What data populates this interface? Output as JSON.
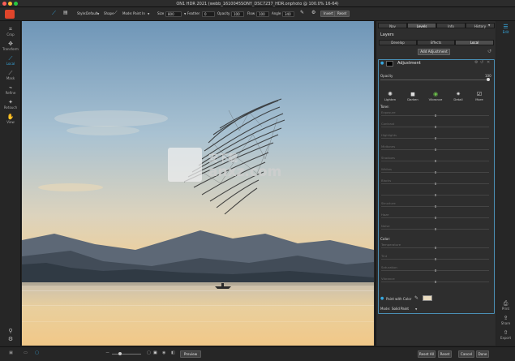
{
  "window": {
    "title": "ON1 HDR 2021 (webb_1610045SONY_DSC7237_HDR.onphoto @ 100.0% 16-64)"
  },
  "toolbar": {
    "style_label": "Style:",
    "style_value": "Default",
    "shape_label": "Shape",
    "mode_label": "Mode:",
    "mode_value": "Paint In",
    "size_label": "Size",
    "size_value": "800",
    "feather_label": "Feather",
    "feather_value": "0",
    "opacity_label": "Opacity",
    "opacity_value": "100",
    "flow_label": "Flow",
    "flow_value": "100",
    "angle_label": "Angle",
    "angle_value": "340",
    "invert_label": "Invert",
    "reset_label": "Reset"
  },
  "left_tools": [
    {
      "label": "Crop",
      "icon": "crop-icon"
    },
    {
      "label": "Transform",
      "icon": "transform-icon"
    },
    {
      "label": "Local",
      "icon": "brush-icon"
    },
    {
      "label": "Mask",
      "icon": "mask-icon"
    },
    {
      "label": "Refine",
      "icon": "refine-icon"
    },
    {
      "label": "Retouch",
      "icon": "retouch-icon"
    },
    {
      "label": "View",
      "icon": "view-icon"
    }
  ],
  "panel": {
    "tabs": [
      "Nav",
      "Levels",
      "Info",
      "History"
    ],
    "layers_heading": "Layers",
    "subtabs": [
      "Develop",
      "Effects",
      "Local"
    ],
    "add_adjustment": "Add Adjustment",
    "adjustment_label": "Adjustment",
    "opacity_label": "Opacity",
    "opacity_value": "100",
    "presets": [
      {
        "label": "Lighten",
        "icon": "sun-icon"
      },
      {
        "label": "Darken",
        "icon": "square-icon"
      },
      {
        "label": "Vibrance",
        "icon": "color-wheel-icon"
      },
      {
        "label": "Detail",
        "icon": "sparkle-icon"
      },
      {
        "label": "More",
        "icon": "checkbox-icon"
      }
    ],
    "tone_heading": "Tone:",
    "tone_rows": [
      "Exposure",
      "Contrast",
      "Highlights",
      "Midtones",
      "Shadows",
      "Whites",
      "Blacks",
      "",
      "Structure",
      "Haze",
      "Noise"
    ],
    "color_heading": "Color:",
    "color_rows": [
      "Temperature",
      "Tint",
      "Saturation",
      "Vibrance"
    ],
    "paint_with_color": "Paint with Color",
    "paint_color": "#eadcc0",
    "mode_label": "Mode:",
    "mode_value": "Solid Paint"
  },
  "right_tools": [
    {
      "label": "Edit",
      "icon": "sliders-icon"
    },
    {
      "label": "Print",
      "icon": "print-icon"
    },
    {
      "label": "Share",
      "icon": "share-icon"
    },
    {
      "label": "Export",
      "icon": "export-icon"
    }
  ],
  "bottom": {
    "preview": "Preview",
    "reset_all": "Reset All",
    "reset": "Reset",
    "cancel": "Cancel",
    "done": "Done"
  },
  "watermark": {
    "text": "anxz.com",
    "cn": "安下载"
  },
  "colors": {
    "accent": "#36a9e1",
    "panel": "#2e2e2e"
  }
}
